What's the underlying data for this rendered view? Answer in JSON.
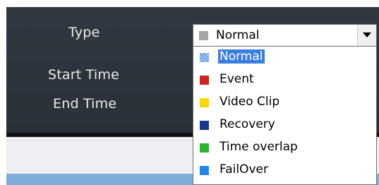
{
  "form": {
    "type_label": "Type",
    "start_time_label": "Start Time",
    "end_time_label": "End Time"
  },
  "type_select": {
    "value": "Normal",
    "swatch_color": "#a5a5a5",
    "arrow_icon": "chevron-down-icon"
  },
  "type_options": [
    {
      "label": "Normal",
      "color": "#6a9fe8",
      "selected": true
    },
    {
      "label": "Event",
      "color": "#d12222",
      "selected": false
    },
    {
      "label": "Video Clip",
      "color": "#ffd500",
      "selected": false
    },
    {
      "label": "Recovery",
      "color": "#163893",
      "selected": false
    },
    {
      "label": "Time overlap",
      "color": "#2eb52e",
      "selected": false
    },
    {
      "label": "FailOver",
      "color": "#1e84f0",
      "selected": false
    }
  ],
  "colors": {
    "panel_background": "#2d343d",
    "label_text": "#e8eaed",
    "selection_highlight": "#3a7fe0"
  }
}
